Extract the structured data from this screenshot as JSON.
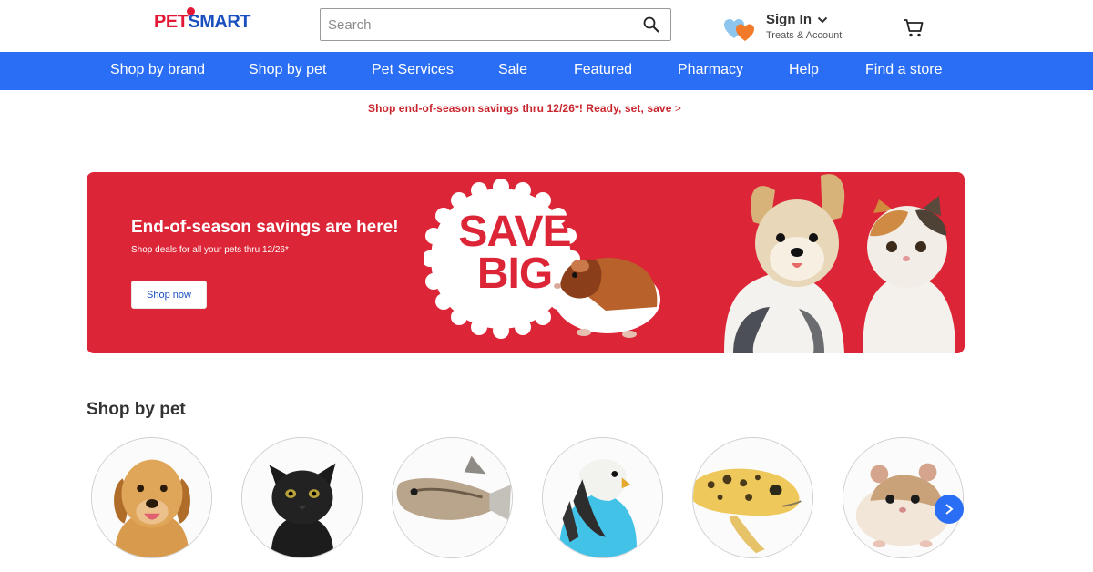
{
  "header": {
    "logo_part1": "PET",
    "logo_part2": "SMART",
    "search_placeholder": "Search",
    "signin_label": "Sign In",
    "signin_sub": "Treats & Account"
  },
  "nav": {
    "items": [
      {
        "label": "Shop by brand"
      },
      {
        "label": "Shop by pet"
      },
      {
        "label": "Pet Services"
      },
      {
        "label": "Sale"
      },
      {
        "label": "Featured"
      },
      {
        "label": "Pharmacy"
      },
      {
        "label": "Help"
      },
      {
        "label": "Find a store"
      }
    ]
  },
  "promo": {
    "text": "Shop end-of-season savings thru 12/26*! Ready, set, save",
    "arrow": ">"
  },
  "hero": {
    "title": "End-of-season savings are here!",
    "subtitle": "Shop deals for all your pets thru 12/26*",
    "button_label": "Shop now",
    "badge_line1": "SAVE",
    "badge_line2": "BIG"
  },
  "shop_by_pet": {
    "title": "Shop by pet",
    "pets": [
      "dog-icon",
      "cat-icon",
      "fish-icon",
      "bird-icon",
      "reptile-icon",
      "small-pet-icon"
    ]
  },
  "colors": {
    "brand_blue": "#2a6ef5",
    "brand_red": "#dc2536",
    "promo_red": "#c8262e"
  }
}
